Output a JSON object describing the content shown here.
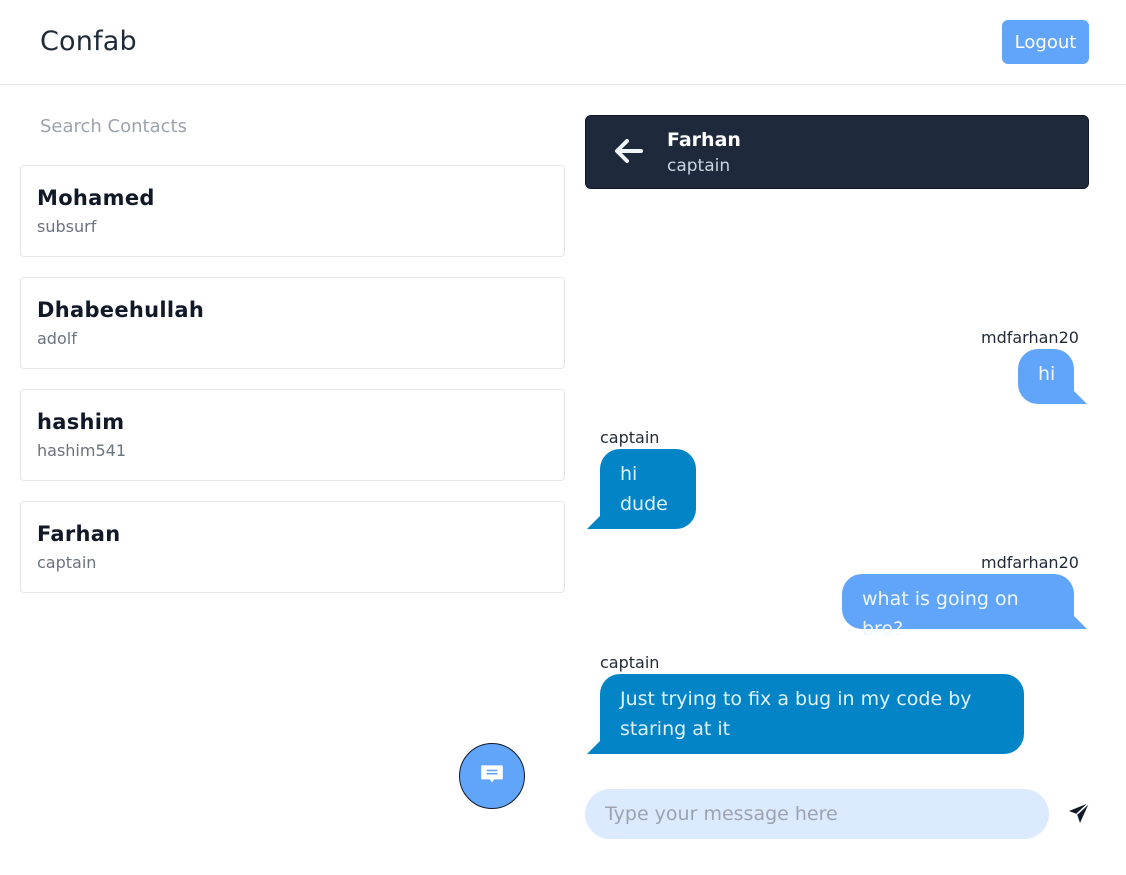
{
  "header": {
    "app_title": "Confab",
    "logout_label": "Logout"
  },
  "sidebar": {
    "search_placeholder": "Search Contacts",
    "contacts": [
      {
        "name": "Mohamed",
        "username": "subsurf"
      },
      {
        "name": "Dhabeehullah",
        "username": "adolf"
      },
      {
        "name": "hashim",
        "username": "hashim541"
      },
      {
        "name": "Farhan",
        "username": "captain"
      }
    ]
  },
  "chat": {
    "contact_name": "Farhan",
    "contact_username": "captain",
    "messages": [
      {
        "sender": "mdfarhan20",
        "direction": "outgoing",
        "lines": [
          "hi"
        ]
      },
      {
        "sender": "captain",
        "direction": "incoming",
        "lines": [
          "hi",
          "dude"
        ]
      },
      {
        "sender": "mdfarhan20",
        "direction": "outgoing",
        "lines": [
          "what is going on bro?"
        ]
      },
      {
        "sender": "captain",
        "direction": "incoming",
        "lines": [
          "Just trying to fix a bug in my code by",
          "staring at it"
        ]
      }
    ],
    "composer_placeholder": "Type your message here"
  },
  "icons": {
    "back": "arrow-left-icon",
    "fab": "chat-bubble-icon",
    "send": "paper-plane-icon"
  },
  "colors": {
    "accent": "#60a5fa",
    "incoming_bubble": "#0284c7",
    "chat_header": "#1e293b",
    "composer_bg": "#dbeafe"
  }
}
